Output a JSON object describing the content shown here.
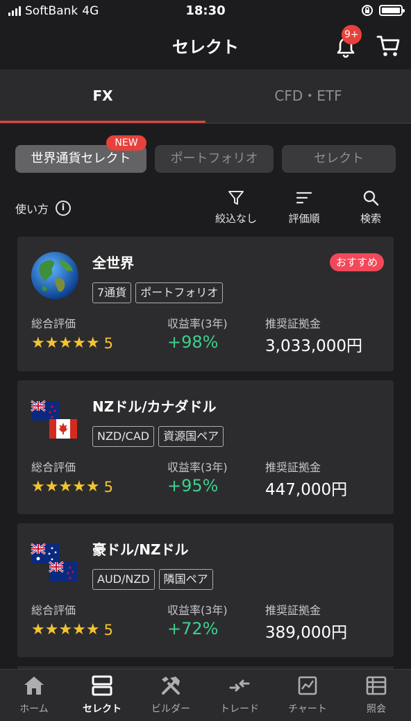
{
  "status_bar": {
    "carrier": "SoftBank",
    "network": "4G",
    "time": "18:30"
  },
  "header": {
    "title": "セレクト",
    "notification_badge": "9+"
  },
  "main_tabs": [
    {
      "label": "FX",
      "active": true
    },
    {
      "label": "CFD・ETF",
      "active": false
    }
  ],
  "chips": [
    {
      "label": "世界通貨セレクト",
      "badge": "NEW",
      "active": true
    },
    {
      "label": "ポートフォリオ",
      "active": false
    },
    {
      "label": "セレクト",
      "active": false
    }
  ],
  "toolbar": {
    "usage_label": "使い方",
    "filter_label": "絞込なし",
    "sort_label": "評価順",
    "search_label": "検索"
  },
  "labels": {
    "rating": "総合評価",
    "return": "収益率(3年)",
    "margin": "推奨証拠金"
  },
  "cards": [
    {
      "title": "全世界",
      "badge": "おすすめ",
      "tags": [
        "7通貨",
        "ポートフォリオ"
      ],
      "stars": "★★★★★",
      "rating": "5",
      "return": "+98%",
      "margin": "3,033,000円",
      "icon": "globe-icon"
    },
    {
      "title": "NZドル/カナダドル",
      "tags": [
        "NZD/CAD",
        "資源国ペア"
      ],
      "stars": "★★★★★",
      "rating": "5",
      "return": "+95%",
      "margin": "447,000円",
      "icon": "nz-ca-flags-icon"
    },
    {
      "title": "豪ドル/NZドル",
      "tags": [
        "AUD/NZD",
        "隣国ペア"
      ],
      "stars": "★★★★★",
      "rating": "5",
      "return": "+72%",
      "margin": "389,000円",
      "icon": "au-nz-flags-icon"
    }
  ],
  "bottom_nav": [
    {
      "label": "ホーム",
      "icon": "home-icon",
      "active": false
    },
    {
      "label": "セレクト",
      "icon": "select-icon",
      "active": true
    },
    {
      "label": "ビルダー",
      "icon": "builder-icon",
      "active": false
    },
    {
      "label": "トレード",
      "icon": "trade-icon",
      "active": false
    },
    {
      "label": "チャート",
      "icon": "chart-icon",
      "active": false
    },
    {
      "label": "照会",
      "icon": "inquiry-icon",
      "active": false
    }
  ],
  "colors": {
    "background": "#1c1c1e",
    "card": "#2c2c2e",
    "accent_red": "#e8413c",
    "return_green": "#3ecf8e",
    "star_yellow": "#f4c430"
  }
}
